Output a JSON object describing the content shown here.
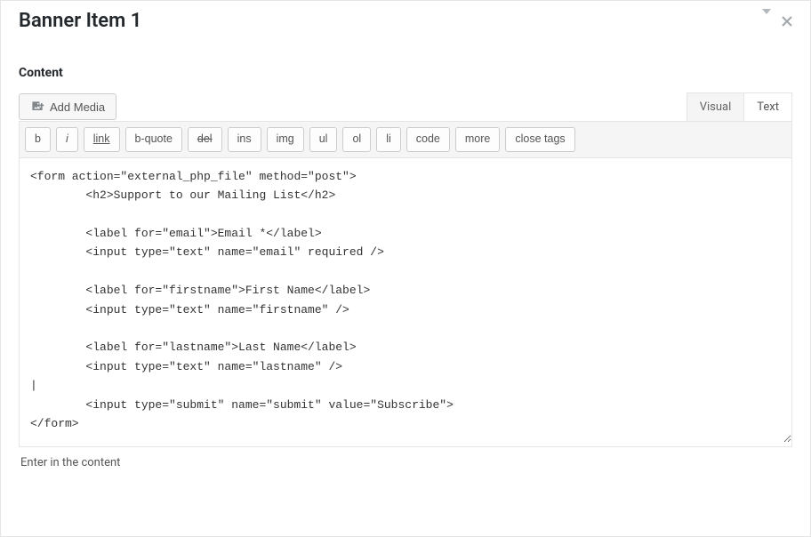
{
  "panel": {
    "title": "Banner Item 1"
  },
  "section": {
    "label": "Content"
  },
  "addMedia": {
    "label": "Add Media"
  },
  "tabs": {
    "visual": "Visual",
    "text": "Text",
    "active": "text"
  },
  "quicktags": {
    "b": "b",
    "i": "i",
    "link": "link",
    "bquote": "b-quote",
    "del": "del",
    "ins": "ins",
    "img": "img",
    "ul": "ul",
    "ol": "ol",
    "li": "li",
    "code": "code",
    "more": "more",
    "close": "close tags"
  },
  "editor": {
    "content": "<form action=\"external_php_file\" method=\"post\">\n        <h2>Support to our Mailing List</h2>\n\n        <label for=\"email\">Email *</label>\n        <input type=\"text\" name=\"email\" required />\n\n        <label for=\"firstname\">First Name</label>\n        <input type=\"text\" name=\"firstname\" />\n\n        <label for=\"lastname\">Last Name</label>\n        <input type=\"text\" name=\"lastname\" />\n|\n        <input type=\"submit\" name=\"submit\" value=\"Subscribe\">\n</form>"
  },
  "help": {
    "text": "Enter in the content"
  }
}
